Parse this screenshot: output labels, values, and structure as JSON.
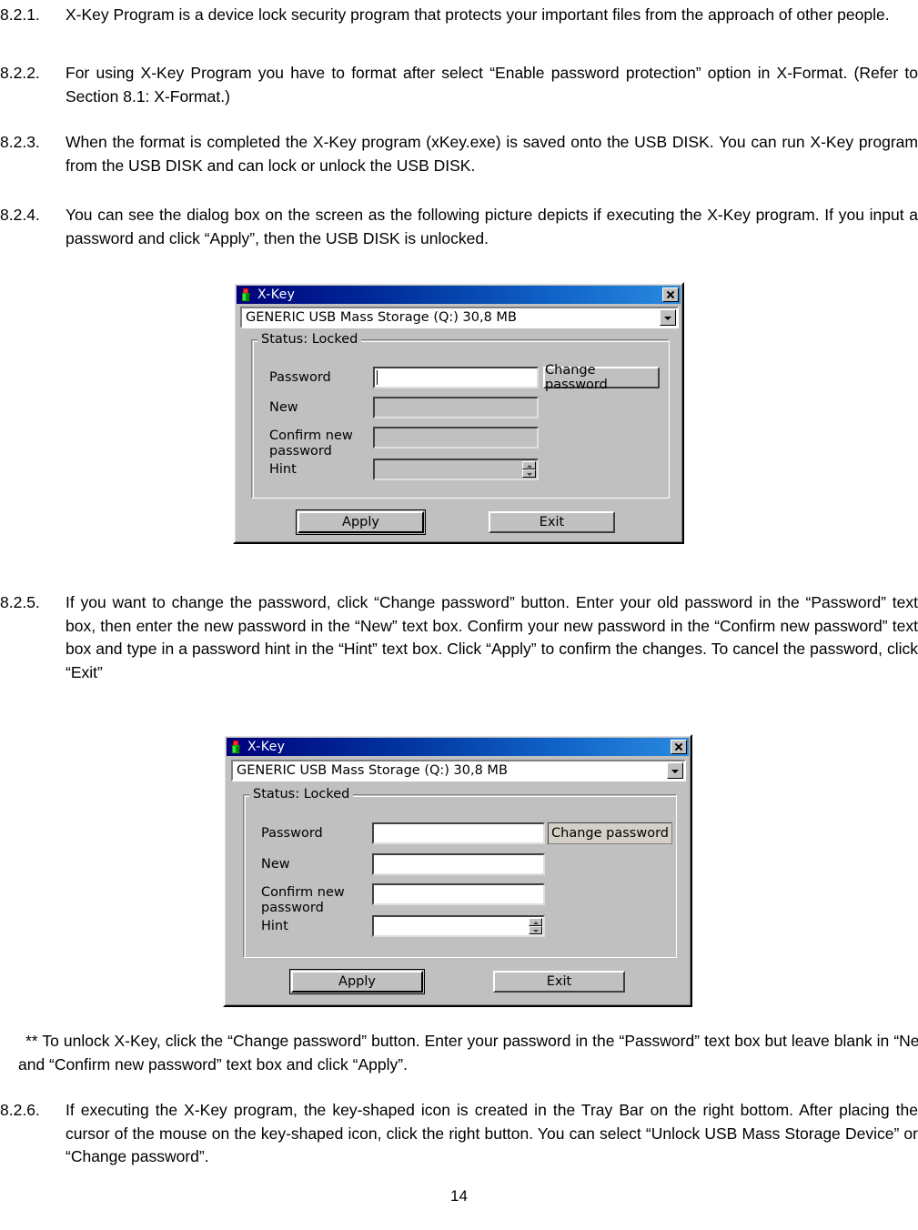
{
  "page": {
    "number": "14"
  },
  "paragraphs": [
    {
      "num": "8.2.1.",
      "text": "X-Key Program is a device lock security program that protects your important files from the approach of other people."
    },
    {
      "num": "8.2.2.",
      "text": "For using X-Key Program you have to format after select “Enable password protection” option in X-Format. (Refer to Section 8.1: X-Format.)"
    },
    {
      "num": "8.2.3.",
      "text": "When the format is completed the X-Key program (xKey.exe) is saved onto the USB DISK. You can run X-Key program from the USB DISK and can lock or unlock the USB DISK."
    },
    {
      "num": "8.2.4.",
      "text": "You can see the dialog box on the screen as the following picture depicts if executing the X-Key program. If you input a password and click “Apply”, then the USB DISK is unlocked."
    },
    {
      "num": "8.2.5.",
      "text": "If you want to change the password, click “Change password” button.  Enter your old password in the “Password” text box, then enter the new password in the “New” text box. Confirm your new password in the “Confirm new password” text box and type in a password hint in the “Hint” text box. Click “Apply” to confirm the changes. To cancel the password, click “Exit”"
    },
    {
      "num": "8.2.6.",
      "text": "If executing the X-Key program, the key-shaped icon is created in the Tray Bar on the right bottom. After placing the cursor of the mouse on the key-shaped icon, click the right button. You can select “Unlock USB Mass Storage Device” or “Change password”."
    }
  ],
  "note": {
    "text": "** To unlock X-Key, click the “Change password” button. Enter your password in the “Password” text box but leave blank in “New” and “Confirm new password” text box and click “Apply”."
  },
  "dialog1": {
    "title": "X-Key",
    "icon": "key-icon",
    "close_label": "×",
    "device_combo": {
      "value": "GENERIC USB Mass Storage (Q:) 30,8 MB"
    },
    "group_legend": "Status: Locked",
    "fields": [
      {
        "label": "Password",
        "value": "",
        "enabled": true,
        "focused": true
      },
      {
        "label": "New",
        "value": "",
        "enabled": false,
        "focused": false
      },
      {
        "label": "Confirm new\npassword",
        "value": "",
        "enabled": false,
        "focused": false
      },
      {
        "label": "Hint",
        "value": "",
        "enabled": false,
        "focused": false
      }
    ],
    "change_password_label": "Change password",
    "apply_label": "Apply",
    "exit_label": "Exit"
  },
  "dialog2": {
    "title": "X-Key",
    "icon": "key-icon",
    "close_label": "×",
    "device_combo": {
      "value": "GENERIC USB Mass Storage (Q:) 30,8 MB"
    },
    "group_legend": "Status: Locked",
    "fields": [
      {
        "label": "Password",
        "value": "",
        "enabled": true,
        "focused": false
      },
      {
        "label": "New",
        "value": "",
        "enabled": true,
        "focused": false
      },
      {
        "label": "Confirm new\npassword",
        "value": "",
        "enabled": true,
        "focused": false
      },
      {
        "label": "Hint",
        "value": "",
        "enabled": true,
        "focused": false
      }
    ],
    "change_password_label": "Change password",
    "apply_label": "Apply",
    "exit_label": "Exit"
  },
  "colors": {
    "dialog_face": "#c0c0c0",
    "titlebar_start": "#00007b",
    "titlebar_end": "#2a8adf",
    "title_text": "#ffffff",
    "field_white": "#ffffff",
    "field_disabled": "#c0c0c0",
    "text": "#000000"
  }
}
